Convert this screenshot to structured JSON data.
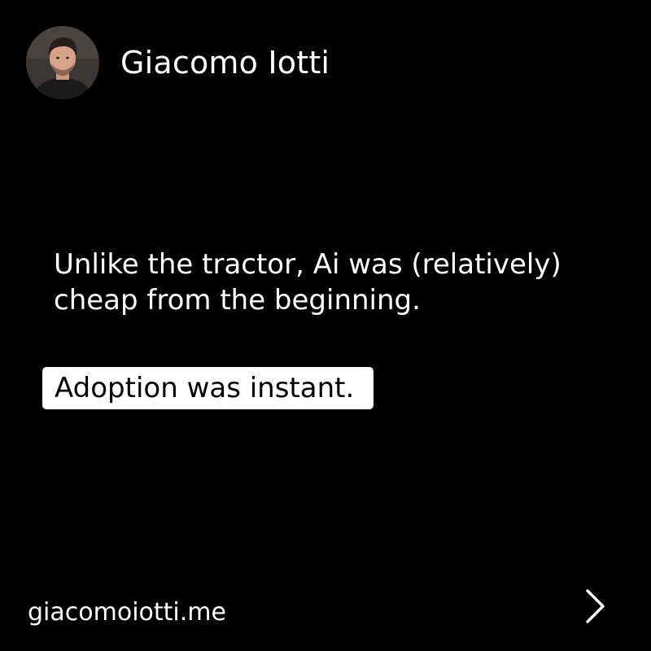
{
  "author": {
    "name": "Giacomo Iotti",
    "avatar_icon": "person-portrait-icon"
  },
  "post": {
    "body_lines": [
      "Unlike the tractor, Ai was (relatively)",
      "cheap from the beginning."
    ],
    "highlight": "Adoption was instant."
  },
  "footer": {
    "website": "giacomoiotti.me",
    "next_icon": "chevron-right-icon"
  },
  "colors": {
    "background": "#000000",
    "text": "#ffffff",
    "highlight_background": "#ffffff",
    "highlight_text": "#000000"
  }
}
